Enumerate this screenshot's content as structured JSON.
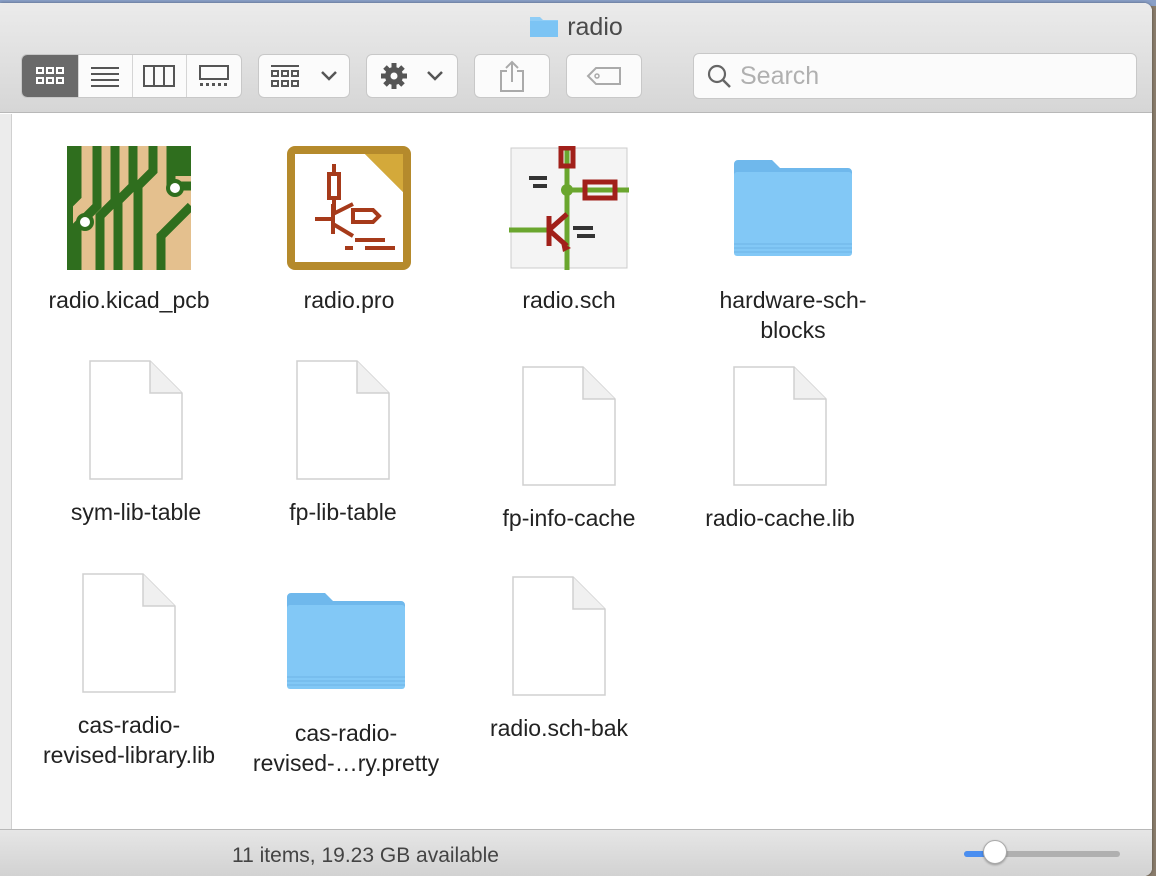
{
  "window": {
    "title": "radio"
  },
  "toolbar": {
    "views": [
      "icon-view",
      "list-view",
      "column-view",
      "gallery-view"
    ],
    "active_view": "icon-view",
    "search_placeholder": "Search",
    "search_value": ""
  },
  "items": [
    {
      "name": "radio.kicad_pcb",
      "icon": "kicad-pcb-icon"
    },
    {
      "name": "radio.pro",
      "icon": "kicad-project-icon"
    },
    {
      "name": "radio.sch",
      "icon": "kicad-schematic-icon"
    },
    {
      "name": "hardware-sch-blocks",
      "icon": "folder-icon"
    },
    {
      "name": "sym-lib-table",
      "icon": "document-icon"
    },
    {
      "name": "fp-lib-table",
      "icon": "document-icon"
    },
    {
      "name": "fp-info-cache",
      "icon": "document-icon"
    },
    {
      "name": "radio-cache.lib",
      "icon": "document-icon"
    },
    {
      "name": "cas-radio-revised-library.lib",
      "icon": "document-icon"
    },
    {
      "name": "cas-radio-revised-…ry.pretty",
      "icon": "folder-icon"
    },
    {
      "name": "radio.sch-bak",
      "icon": "document-icon"
    }
  ],
  "status": {
    "text": "11 items, 19.23 GB available",
    "icon_size_slider": 0.2
  },
  "colors": {
    "folder": "#7cc4f4",
    "accent": "#4a8ef0"
  }
}
